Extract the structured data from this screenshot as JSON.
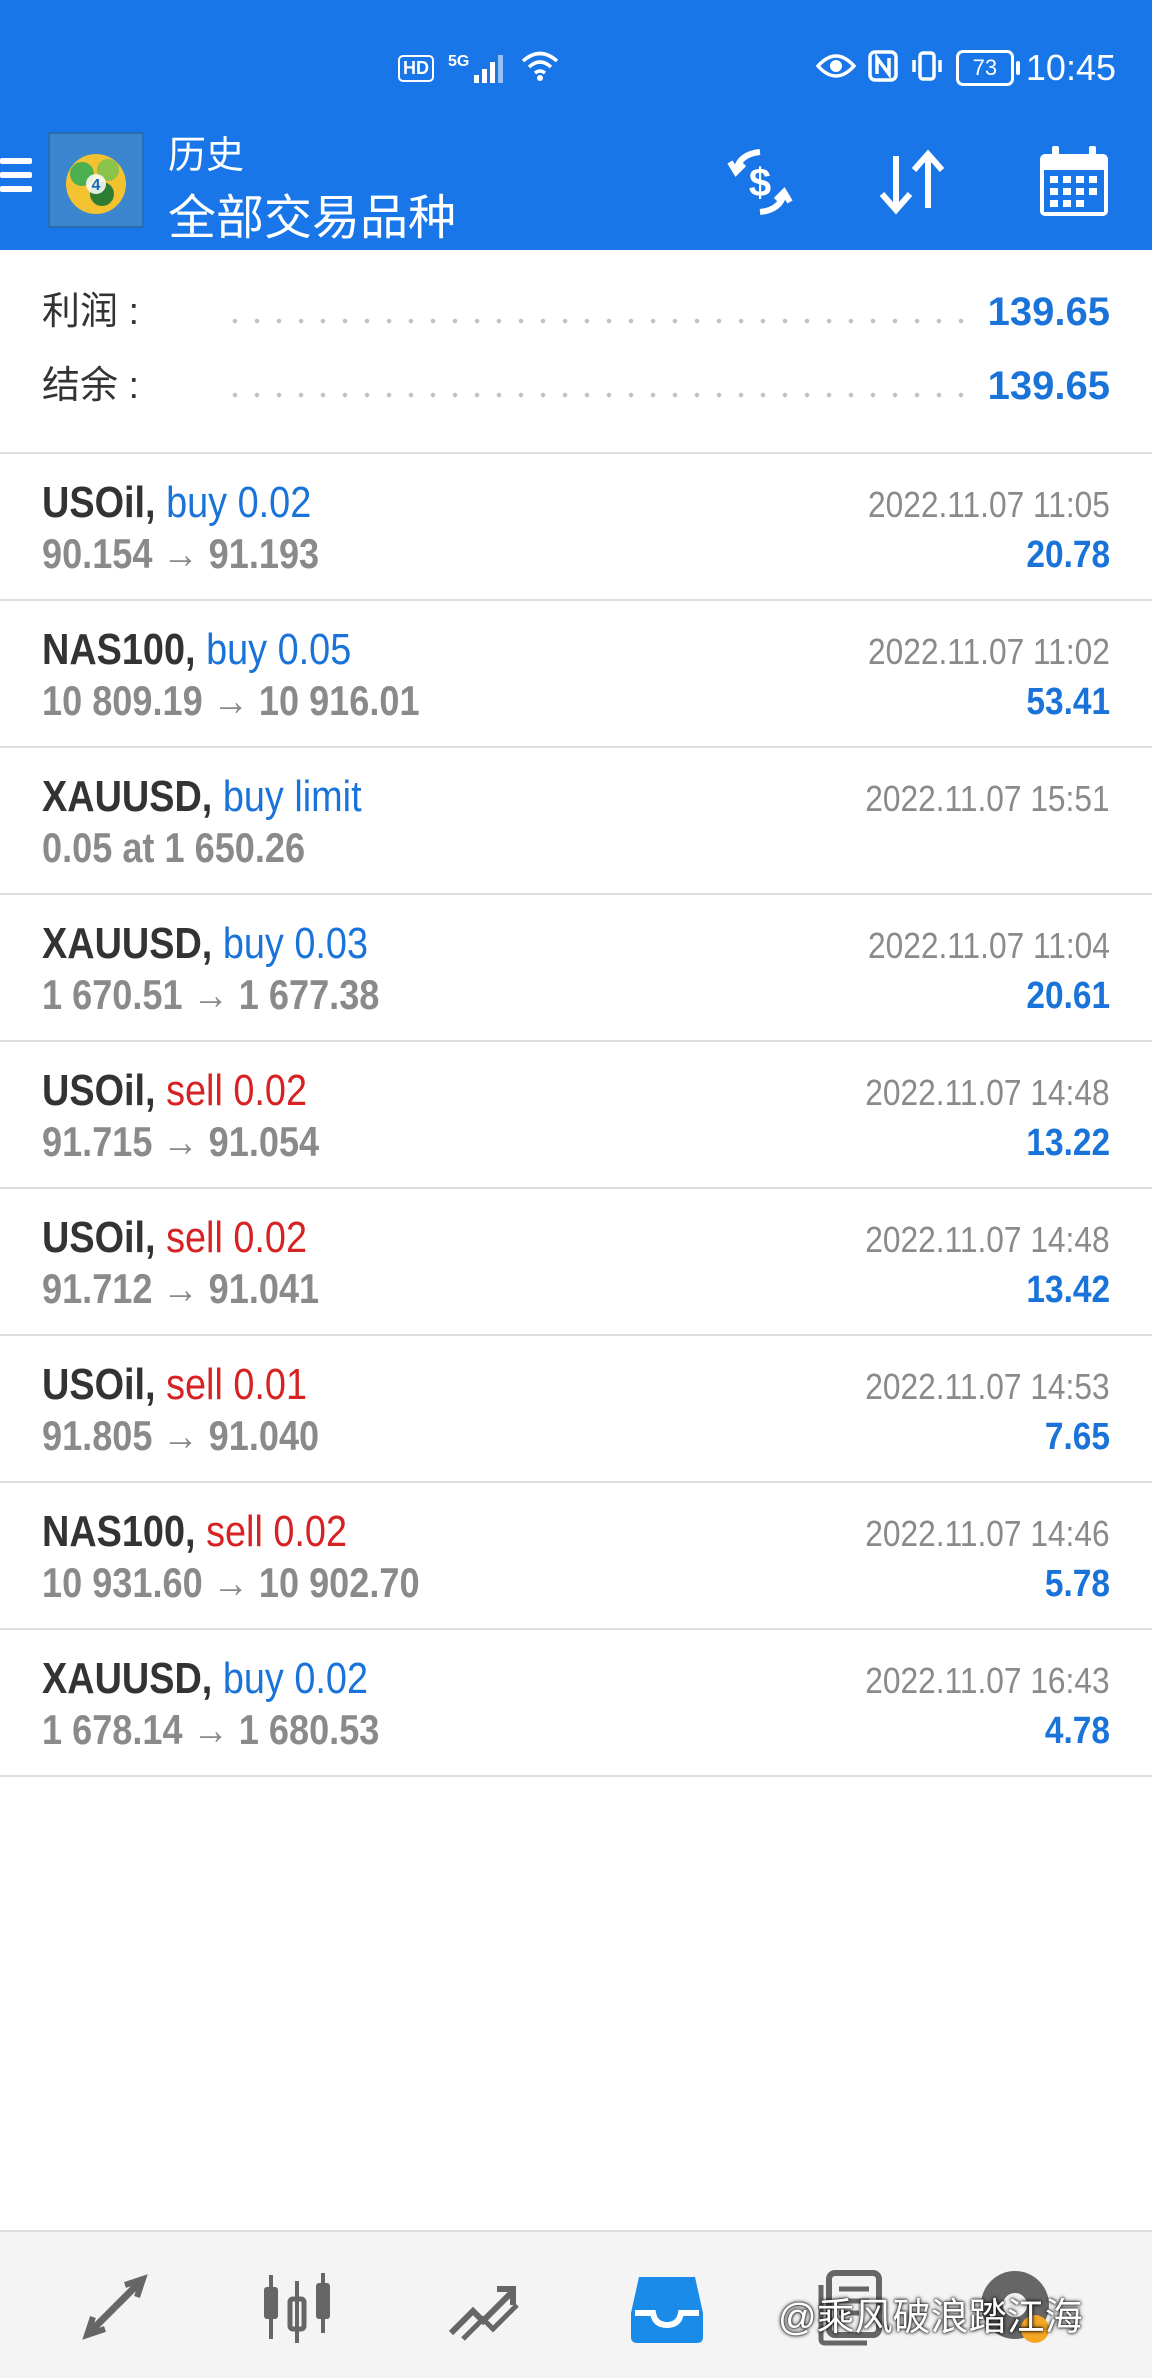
{
  "status_bar": {
    "hd": "HD",
    "network": "5G",
    "battery": "73",
    "time": "10:45"
  },
  "header": {
    "title_small": "历史",
    "title_main": "全部交易品种",
    "accent_color": "#1976e8"
  },
  "summary": {
    "profit_label": "利润 :",
    "profit_value": "139.65",
    "balance_label": "结余 :",
    "balance_value": "139.65"
  },
  "trades": [
    {
      "symbol": "USOil,",
      "action": "buy 0.02",
      "side": "buy",
      "prices": "90.154 → 91.193",
      "time": "2022.11.07 11:05",
      "profit": "20.78"
    },
    {
      "symbol": "NAS100,",
      "action": "buy 0.05",
      "side": "buy",
      "prices": "10 809.19 → 10 916.01",
      "time": "2022.11.07 11:02",
      "profit": "53.41"
    },
    {
      "symbol": "XAUUSD,",
      "action": "buy limit",
      "side": "buy",
      "prices": "0.05 at 1 650.26",
      "time": "2022.11.07 15:51",
      "profit": ""
    },
    {
      "symbol": "XAUUSD,",
      "action": "buy 0.03",
      "side": "buy",
      "prices": "1 670.51 → 1 677.38",
      "time": "2022.11.07 11:04",
      "profit": "20.61"
    },
    {
      "symbol": "USOil,",
      "action": "sell 0.02",
      "side": "sell",
      "prices": "91.715 → 91.054",
      "time": "2022.11.07 14:48",
      "profit": "13.22"
    },
    {
      "symbol": "USOil,",
      "action": "sell 0.02",
      "side": "sell",
      "prices": "91.712 → 91.041",
      "time": "2022.11.07 14:48",
      "profit": "13.42"
    },
    {
      "symbol": "USOil,",
      "action": "sell 0.01",
      "side": "sell",
      "prices": "91.805 → 91.040",
      "time": "2022.11.07 14:53",
      "profit": "7.65"
    },
    {
      "symbol": "NAS100,",
      "action": "sell 0.02",
      "side": "sell",
      "prices": "10 931.60 → 10 902.70",
      "time": "2022.11.07 14:46",
      "profit": "5.78"
    },
    {
      "symbol": "XAUUSD,",
      "action": "buy 0.02",
      "side": "buy",
      "prices": "1 678.14 → 1 680.53",
      "time": "2022.11.07 16:43",
      "profit": "4.78"
    }
  ],
  "bottom_nav": {
    "items": [
      {
        "icon": "quotes-icon"
      },
      {
        "icon": "chart-icon"
      },
      {
        "icon": "trade-icon"
      },
      {
        "icon": "history-icon",
        "active": true
      },
      {
        "icon": "messages-icon"
      },
      {
        "icon": "settings-icon"
      }
    ],
    "active_color": "#1a8be8",
    "icon_color": "#666666"
  },
  "watermark": "@乘风破浪踏江海",
  "colors": {
    "buy": "#1a73d9",
    "sell": "#d62222",
    "muted": "#8a8a8a"
  }
}
